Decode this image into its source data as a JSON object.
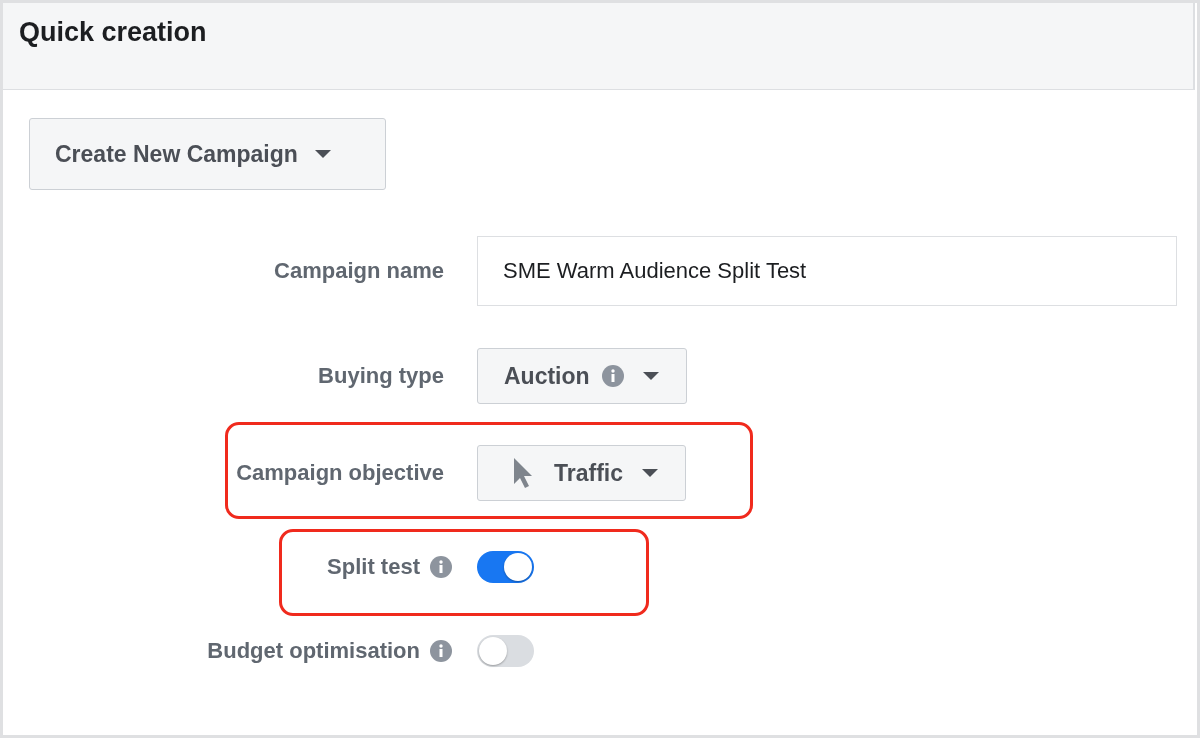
{
  "header": {
    "title": "Quick creation"
  },
  "campaign_button": {
    "label": "Create New Campaign"
  },
  "rows": [
    {
      "kind": "text",
      "label": "Campaign name",
      "info": false,
      "value": "SME Warm Audience Split Test",
      "highlighted": false
    },
    {
      "kind": "dropdown",
      "label": "Buying type",
      "info": false,
      "value": "Auction",
      "value_info": true,
      "icon": false,
      "highlighted": false
    },
    {
      "kind": "dropdown",
      "label": "Campaign objective",
      "info": false,
      "value": "Traffic",
      "value_info": false,
      "icon": true,
      "highlighted": true
    },
    {
      "kind": "toggle",
      "label": "Split test",
      "info": true,
      "on": true,
      "highlighted": true
    },
    {
      "kind": "toggle",
      "label": "Budget optimisation",
      "info": true,
      "on": false,
      "highlighted": false
    }
  ]
}
